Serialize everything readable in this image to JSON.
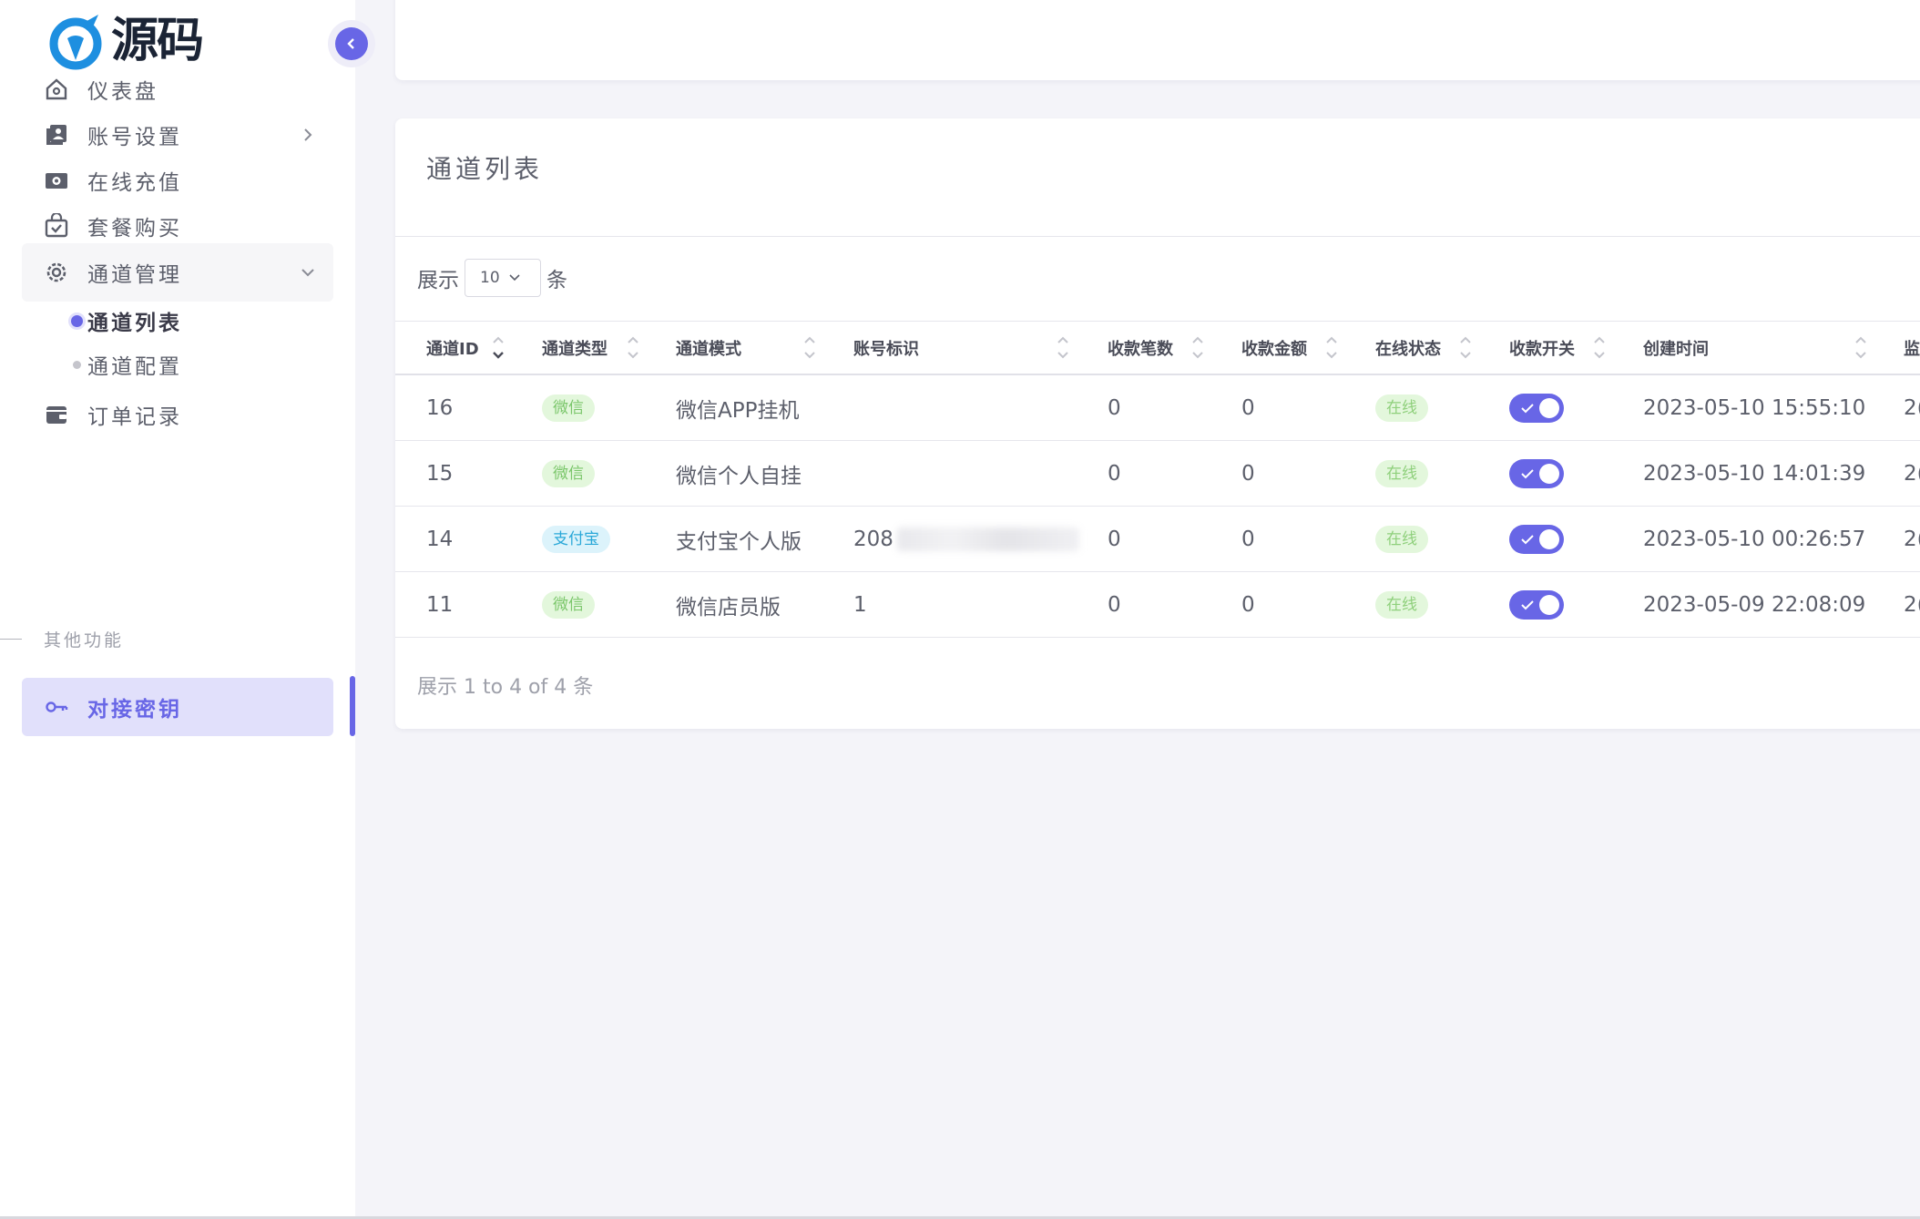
{
  "brand": {
    "name": "源码",
    "accent": "#6866e6"
  },
  "sidebar": {
    "items": [
      {
        "label": "仪表盘",
        "icon": "home-icon"
      },
      {
        "label": "账号设置",
        "icon": "user-card-icon"
      },
      {
        "label": "在线充值",
        "icon": "money-icon"
      },
      {
        "label": "套餐购买",
        "icon": "shopping-bag-icon"
      },
      {
        "label": "通道管理",
        "icon": "gear-icon"
      },
      {
        "label": "订单记录",
        "icon": "wallet-icon"
      }
    ],
    "submenu": [
      {
        "label": "通道列表"
      },
      {
        "label": "通道配置"
      }
    ],
    "section_label": "其他功能",
    "active_item": {
      "label": "对接密钥",
      "icon": "key-icon"
    }
  },
  "card": {
    "title": "通道列表",
    "length_prefix": "展示",
    "length_value": "10",
    "length_suffix": "条",
    "columns": [
      "通道ID",
      "通道类型",
      "通道模式",
      "账号标识",
      "收款笔数",
      "收款金额",
      "在线状态",
      "收款开关",
      "创建时间",
      "监"
    ],
    "rows": [
      {
        "id": "16",
        "type": "微信",
        "type_color": "green",
        "mode": "微信APP挂机",
        "account": "",
        "count": "0",
        "amount": "0",
        "status": "在线",
        "enabled": true,
        "created": "2023-05-10 15:55:10",
        "extra": "2("
      },
      {
        "id": "15",
        "type": "微信",
        "type_color": "green",
        "mode": "微信个人自挂",
        "account": "",
        "count": "0",
        "amount": "0",
        "status": "在线",
        "enabled": true,
        "created": "2023-05-10 14:01:39",
        "extra": "2("
      },
      {
        "id": "14",
        "type": "支付宝",
        "type_color": "blue",
        "mode": "支付宝个人版",
        "account": "208",
        "count": "0",
        "amount": "0",
        "status": "在线",
        "enabled": true,
        "created": "2023-05-10 00:26:57",
        "extra": "2("
      },
      {
        "id": "11",
        "type": "微信",
        "type_color": "green",
        "mode": "微信店员版",
        "account": "1",
        "count": "0",
        "amount": "0",
        "status": "在线",
        "enabled": true,
        "created": "2023-05-09 22:08:09",
        "extra": "2("
      }
    ],
    "footer": "展示 1 to 4 of 4 条"
  }
}
